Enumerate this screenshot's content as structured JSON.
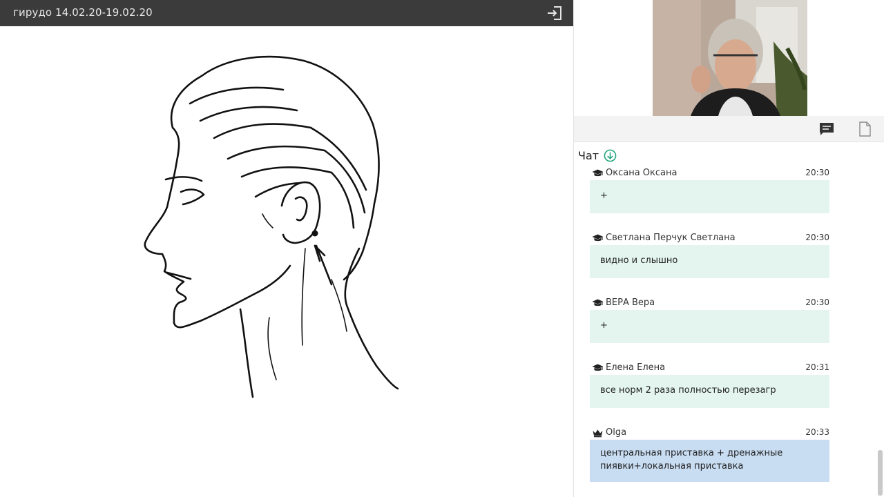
{
  "presentation": {
    "title": "гирудо 14.02.20-19.02.20",
    "exit_icon": "exit-icon",
    "slide_icon": "head-profile-illustration"
  },
  "toolbar": {
    "chat_icon": "chat-icon",
    "file_icon": "file-icon"
  },
  "chat": {
    "header": "Чат",
    "download_icon": "download-icon",
    "messages": [
      {
        "author": "Оксана Оксана",
        "time": "20:30",
        "text": "+",
        "role": "student",
        "icon": "graduation-cap-icon"
      },
      {
        "author": "Светлана Перчук Светлана",
        "time": "20:30",
        "text": "видно и слышно",
        "role": "student",
        "icon": "graduation-cap-icon"
      },
      {
        "author": "ВЕРА Вера",
        "time": "20:30",
        "text": "+",
        "role": "student",
        "icon": "graduation-cap-icon"
      },
      {
        "author": "Елена Елена",
        "time": "20:31",
        "text": "все норм 2 раза полностью перезагр",
        "role": "student",
        "icon": "graduation-cap-icon"
      },
      {
        "author": "Olga",
        "time": "20:33",
        "text": "центральная приставка + дренажные пиявки+локальная приставка",
        "role": "host",
        "icon": "crown-icon"
      }
    ]
  },
  "colors": {
    "topbar_bg": "#3b3b3b",
    "student_bubble": "#e3f5ee",
    "host_bubble": "#c8dcf2",
    "accent_green": "#1aa37a"
  }
}
